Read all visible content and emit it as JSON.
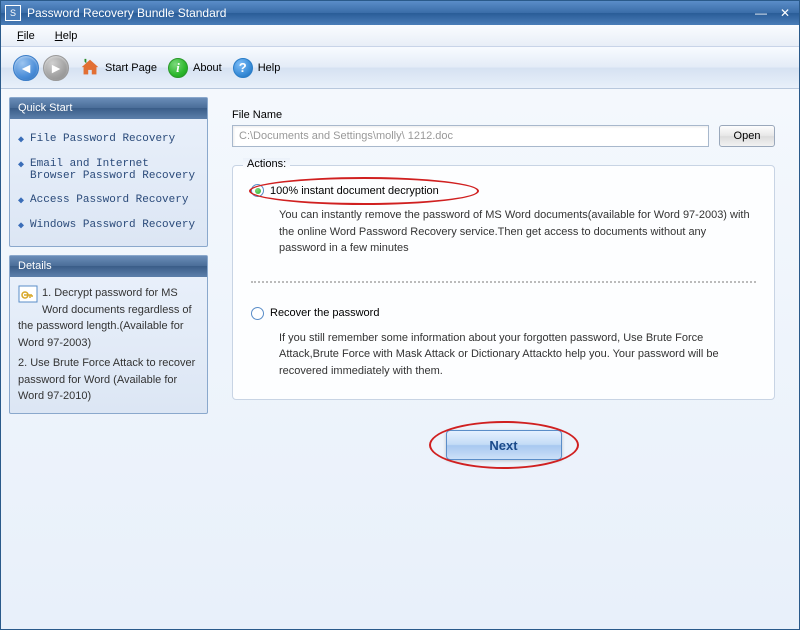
{
  "window": {
    "title": "Password Recovery Bundle Standard"
  },
  "menu": {
    "file": "File",
    "help": "Help"
  },
  "toolbar": {
    "start_page": "Start Page",
    "about": "About",
    "help": "Help"
  },
  "sidebar": {
    "quick_start": {
      "title": "Quick Start",
      "items": [
        "File Password Recovery",
        "Email and Internet Browser Password Recovery",
        "Access Password Recovery",
        "Windows Password Recovery"
      ]
    },
    "details": {
      "title": "Details",
      "text1": "1. Decrypt password for MS Word documents regardless of the password length.(Available for Word 97-2003)",
      "text2": "2. Use Brute Force Attack to recover password for Word (Available for Word 97-2010)"
    }
  },
  "main": {
    "file_name_label": "File Name",
    "file_path": "C:\\Documents and Settings\\molly\\ 1212.doc",
    "open_label": "Open",
    "actions_label": "Actions:",
    "option1": {
      "label": "100% instant document decryption",
      "desc": "You can instantly remove the password of MS Word documents(available for Word 97-2003) with the online Word Password Recovery service.Then get access to documents without any password in a few minutes"
    },
    "option2": {
      "label": "Recover the password",
      "desc": "If you still remember some information about your forgotten password, Use Brute Force Attack,Brute Force with Mask Attack or Dictionary Attackto help you. Your password will be recovered immediately with them."
    },
    "next_label": "Next"
  }
}
